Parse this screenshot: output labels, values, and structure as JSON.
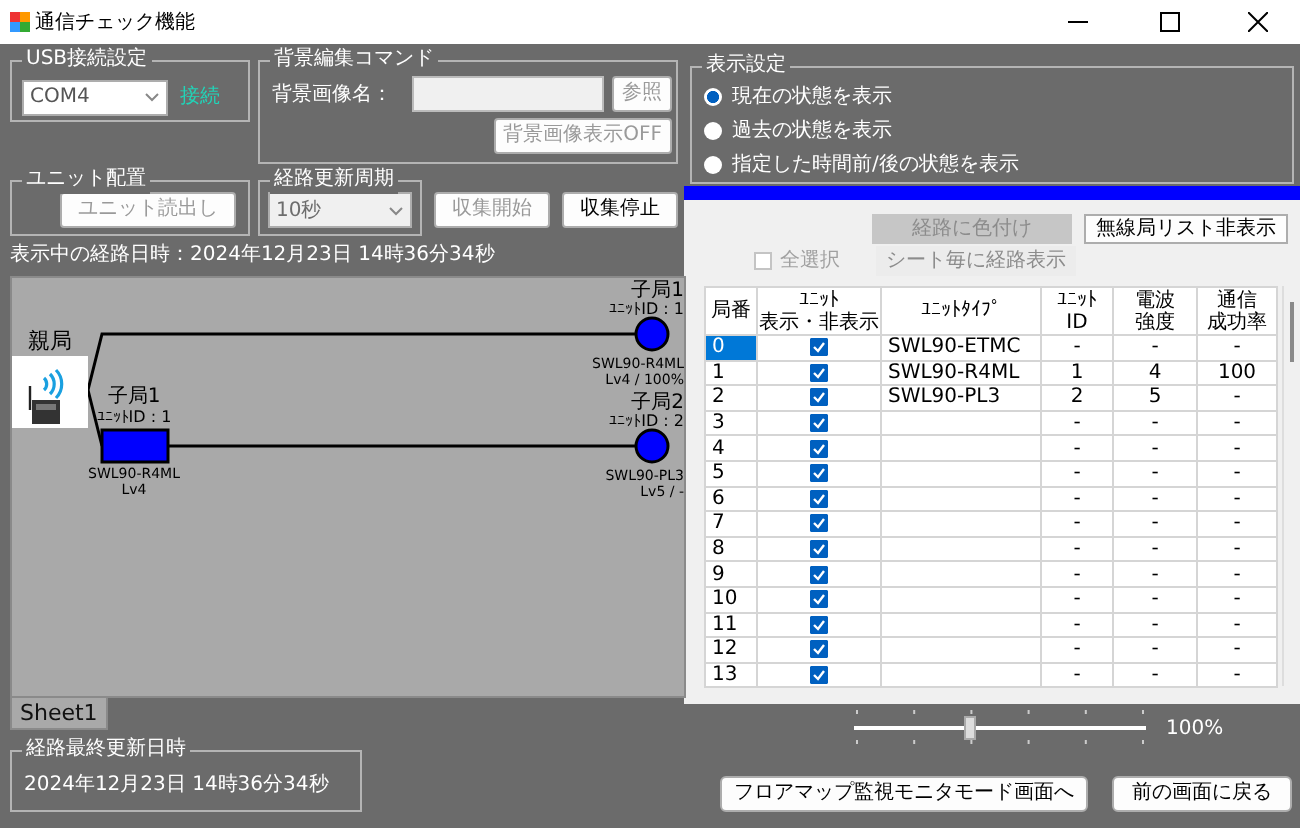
{
  "window": {
    "title": "通信チェック機能"
  },
  "usb": {
    "title": "USB接続設定",
    "port": {
      "value": "COM4",
      "disabled": false
    },
    "status": "接続"
  },
  "background": {
    "title": "背景編集コマンド",
    "label": "背景画像名：",
    "buttons": [
      {
        "label": "参照",
        "disabled": true
      },
      {
        "label": "背景画像表示OFF",
        "disabled": true
      }
    ]
  },
  "unit_layout": {
    "title": "ユニット配置",
    "button": {
      "label": "ユニット読出し",
      "disabled": true
    }
  },
  "update_cycle": {
    "title": "経路更新周期",
    "select": {
      "value": "10秒",
      "disabled": true
    }
  },
  "collect_buttons": [
    {
      "label": "収集開始",
      "disabled": true
    },
    {
      "label": "収集停止",
      "disabled": false
    }
  ],
  "route_time": "表示中の経路日時：2024年12月23日 14時36分34秒",
  "diagram": {
    "master": {
      "label": "親局"
    },
    "routes": [
      {
        "nodes": [
          {
            "kind": "end",
            "title": "子局1",
            "unit_id": "ﾕﾆｯﾄID : 1",
            "model": "SWL90-R4ML",
            "status": "Lv4 / 100%"
          }
        ]
      },
      {
        "nodes": [
          {
            "kind": "repeater",
            "title": "子局1",
            "unit_id": "ﾕﾆｯﾄID : 1",
            "model": "SWL90-R4ML",
            "status": "Lv4"
          },
          {
            "kind": "end",
            "title": "子局2",
            "unit_id": "ﾕﾆｯﾄID : 2",
            "model": "SWL90-PL3",
            "status": "Lv5 / -"
          }
        ]
      }
    ]
  },
  "sheet_tabs": [
    {
      "label": "Sheet1",
      "selected": true
    }
  ],
  "last_update": {
    "title": "経路最終更新日時",
    "value": "2024年12月23日 14時36分34秒"
  },
  "display_settings": {
    "title": "表示設定",
    "options": [
      {
        "label": "現在の状態を表示",
        "selected": true
      },
      {
        "label": "過去の状態を表示",
        "selected": false
      },
      {
        "label": "指定した時間前/後の状態を表示",
        "selected": false
      }
    ]
  },
  "list_panel": {
    "buttons": [
      {
        "label": "経路に色付け",
        "kind": "shaded",
        "disabled": true
      },
      {
        "label": "無線局リスト非表示",
        "kind": "raised",
        "disabled": false
      },
      {
        "label": "シート毎に経路表示",
        "kind": "flat",
        "disabled": true
      }
    ],
    "select_all": {
      "label": "全選択",
      "checked": false,
      "disabled": true
    }
  },
  "table": {
    "columns": [
      {
        "lines": [
          "局番"
        ]
      },
      {
        "lines": [
          "ﾕﾆｯﾄ",
          "表示・非表示"
        ]
      },
      {
        "lines": [
          "ﾕﾆｯﾄﾀｲﾌﾟ"
        ]
      },
      {
        "lines": [
          "ﾕﾆｯﾄ",
          "ID"
        ]
      },
      {
        "lines": [
          "電波",
          "強度"
        ]
      },
      {
        "lines": [
          "通信",
          "成功率"
        ]
      }
    ],
    "rows": [
      {
        "no": "0",
        "visible": true,
        "type": "SWL90-ETMC",
        "id": "-",
        "strength": "-",
        "rate": "-",
        "selected": true
      },
      {
        "no": "1",
        "visible": true,
        "type": "SWL90-R4ML",
        "id": "1",
        "strength": "4",
        "rate": "100",
        "selected": false
      },
      {
        "no": "2",
        "visible": true,
        "type": "SWL90-PL3",
        "id": "2",
        "strength": "5",
        "rate": "-",
        "selected": false
      },
      {
        "no": "3",
        "visible": true,
        "id": "-",
        "strength": "-",
        "rate": "-",
        "selected": false
      },
      {
        "no": "4",
        "visible": true,
        "id": "-",
        "strength": "-",
        "rate": "-",
        "selected": false
      },
      {
        "no": "5",
        "visible": true,
        "id": "-",
        "strength": "-",
        "rate": "-",
        "selected": false
      },
      {
        "no": "6",
        "visible": true,
        "id": "-",
        "strength": "-",
        "rate": "-",
        "selected": false
      },
      {
        "no": "7",
        "visible": true,
        "id": "-",
        "strength": "-",
        "rate": "-",
        "selected": false
      },
      {
        "no": "8",
        "visible": true,
        "id": "-",
        "strength": "-",
        "rate": "-",
        "selected": false
      },
      {
        "no": "9",
        "visible": true,
        "id": "-",
        "strength": "-",
        "rate": "-",
        "selected": false
      },
      {
        "no": "10",
        "visible": true,
        "id": "-",
        "strength": "-",
        "rate": "-",
        "selected": false
      },
      {
        "no": "11",
        "visible": true,
        "id": "-",
        "strength": "-",
        "rate": "-",
        "selected": false
      },
      {
        "no": "12",
        "visible": true,
        "id": "-",
        "strength": "-",
        "rate": "-",
        "selected": false
      },
      {
        "no": "13",
        "visible": true,
        "id": "-",
        "strength": "-",
        "rate": "-",
        "selected": false
      }
    ]
  },
  "zoom": {
    "level": 0.4,
    "reading": "100%"
  },
  "footer_buttons": [
    {
      "label": "フロアマップ監視モニタモード画面へ"
    },
    {
      "label": "前の画面に戻る"
    }
  ]
}
